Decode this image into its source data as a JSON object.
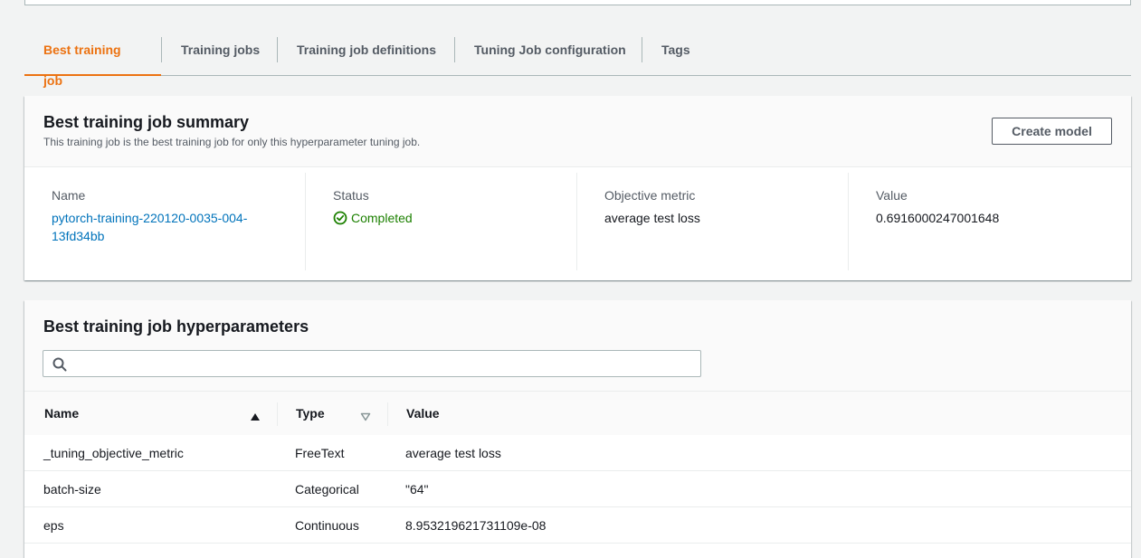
{
  "tabs": [
    {
      "label": "Best training job",
      "active": true
    },
    {
      "label": "Training jobs",
      "active": false
    },
    {
      "label": "Training job definitions",
      "active": false
    },
    {
      "label": "Tuning Job configuration",
      "active": false
    },
    {
      "label": "Tags",
      "active": false
    }
  ],
  "summary": {
    "title": "Best training job summary",
    "description": "This training job is the best training job for only this hyperparameter tuning job.",
    "create_model_label": "Create model",
    "name_label": "Name",
    "name_value_line1": "pytorch-training-220120-0035-004-",
    "name_value_line2": "13fd34bb",
    "status_label": "Status",
    "status_value": "Completed",
    "metric_label": "Objective metric",
    "metric_value": "average test loss",
    "value_label": "Value",
    "value_value": "0.6916000247001648"
  },
  "hyperparameters": {
    "title": "Best training job hyperparameters",
    "search_placeholder": "",
    "columns": [
      "Name",
      "Type",
      "Value"
    ],
    "rows": [
      {
        "name": "_tuning_objective_metric",
        "type": "FreeText",
        "value": "average test loss"
      },
      {
        "name": "batch-size",
        "type": "Categorical",
        "value": "\"64\""
      },
      {
        "name": "eps",
        "type": "Continuous",
        "value": "8.953219621731109e-08"
      }
    ]
  },
  "colors": {
    "accent": "#ec7211",
    "link": "#0073bb",
    "success": "#1d8102"
  }
}
